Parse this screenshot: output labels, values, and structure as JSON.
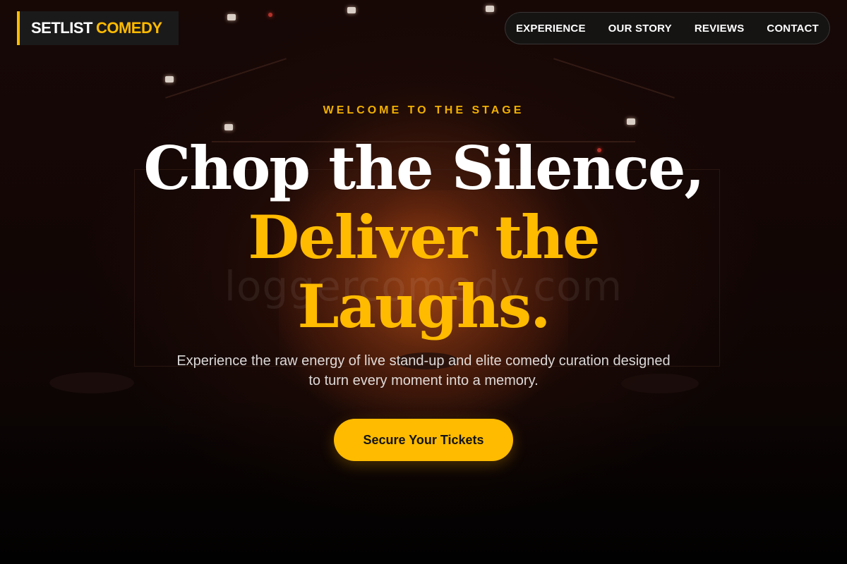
{
  "brand": {
    "word1": "SETLIST",
    "word2": "COMEDY",
    "accent_color": "#ffbb00"
  },
  "nav": {
    "items": [
      {
        "label": "EXPERIENCE"
      },
      {
        "label": "OUR STORY"
      },
      {
        "label": "REVIEWS"
      },
      {
        "label": "CONTACT"
      }
    ]
  },
  "hero": {
    "eyebrow": "WELCOME TO THE STAGE",
    "headline_line1": "Chop the Silence,",
    "headline_line2": "Deliver the",
    "headline_line3": "Laughs.",
    "subtitle": "Experience the raw energy of live stand-up and elite comedy curation designed to turn every moment into a memory.",
    "cta_label": "Secure Your Tickets"
  },
  "watermark": "loggercomedy.com"
}
